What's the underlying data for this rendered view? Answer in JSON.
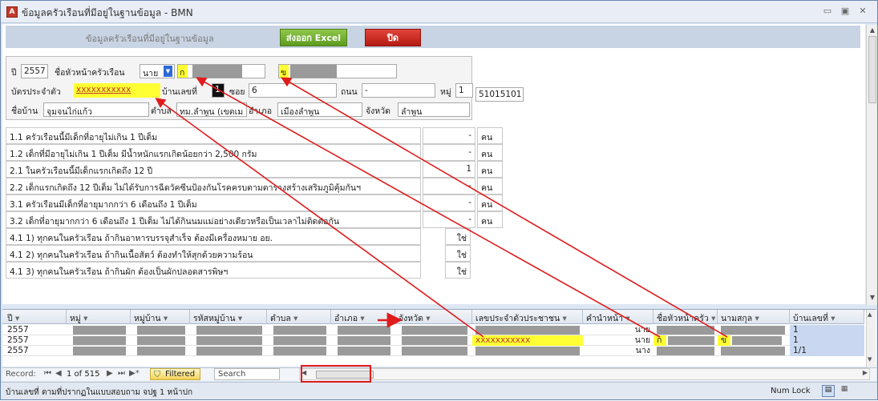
{
  "window": {
    "title": "ข้อมูลครัวเรือนที่มีอยู่ในฐานข้อมูล - BMN",
    "app_icon": "A"
  },
  "header": {
    "title": "ข้อมูลครัวเรือนที่มีอยู่ในฐานข้อมูล",
    "excel_label": "ส่งออก Excel",
    "close_label": "ปิด"
  },
  "info": {
    "year_label": "ปี",
    "year": "2557",
    "head_label": "ชื่อหัวหน้าครัวเรือน",
    "prefix": "นาย",
    "first": "ก",
    "last": "ข",
    "id_label": "บัตรประจำตัว",
    "id_value": "xxxxxxxxxxx",
    "house_label": "บ้านเลขที่",
    "house_no": "1",
    "soi_label": "ซอย",
    "soi": "6",
    "road_label": "ถนน",
    "road": "-",
    "moo_label": "หมู่",
    "moo": "1",
    "code": "51015101",
    "village_label": "ชื่อบ้าน",
    "village": "จุมจนไก่แก้ว",
    "tambon_label": "ตำบล",
    "tambon": "ทม.ลำพูน (เขตเม",
    "amphoe_label": "อำเภอ",
    "amphoe": "เมืองลำพูน",
    "province_label": "จังหวัด",
    "province": "ลำพูน"
  },
  "questions": [
    {
      "text": "1.1 ครัวเรือนนี้มีเด็กที่อายุไม่เกิน 1 ปีเต็ม",
      "value": "-",
      "unit": "คน"
    },
    {
      "text": "1.2 เด็กที่มีอายุไม่เกิน 1 ปีเต็ม มีน้ำหนักแรกเกิดน้อยกว่า 2,500 กรัม",
      "value": "-",
      "unit": "คน"
    },
    {
      "text": "2.1 ในครัวเรือนนี้มีเด็กแรกเกิดถึง 12 ปี",
      "value": "1",
      "unit": "คน"
    },
    {
      "text": "2.2 เด็กแรกเกิดถึง 12 ปีเต็ม ไม่ได้รับการฉีดวัคซีนป้องกันโรคครบตามตารางสร้างเสริมภูมิคุ้มกันฯ",
      "value": "-",
      "unit": "คน"
    },
    {
      "text": "3.1 ครัวเรือนมีเด็กที่อายุมากกว่า 6 เดือนถึง 1 ปีเต็ม",
      "value": "-",
      "unit": "คน"
    },
    {
      "text": "3.2 เด็กที่อายุมากกว่า 6 เดือนถึง 1 ปีเต็ม ไม่ได้กินนมแม่อย่างเดียวหรือเป็นเวลาไม่ติดต่อกัน",
      "value": "-",
      "unit": "คน"
    },
    {
      "text": "4.1 1) ทุกคนในครัวเรือน ถ้ากินอาหารบรรจุสำเร็จ ต้องมีเครื่องหมาย อย.",
      "value": "ใช่",
      "unit": ""
    },
    {
      "text": "4.1 2) ทุกคนในครัวเรือน ถ้ากินเนื้อสัตว์ ต้องทำให้สุกด้วยความร้อน",
      "value": "ใช่",
      "unit": ""
    },
    {
      "text": "4.1 3) ทุกคนในครัวเรือน ถ้ากินผัก ต้องเป็นผักปลอดสารพิษฯ",
      "value": "ใช่",
      "unit": ""
    }
  ],
  "grid": {
    "headers": [
      "ปี",
      "หมู่",
      "หมู่บ้าน",
      "รหัสหมู่บ้าน",
      "ตำบล",
      "อำเภอ",
      "จังหวัด",
      "เลขประจำตัวประชาชน",
      "คำนำหน้า",
      "ชื่อหัวหน้าครัว",
      "นามสกุล",
      "บ้านเลขที่"
    ],
    "rows": [
      {
        "year": "2557",
        "id": "",
        "prefix": "นาย",
        "first": "",
        "last": "",
        "house": "1"
      },
      {
        "year": "2557",
        "id": "xxxxxxxxxxx",
        "prefix": "นาย",
        "first": "ก",
        "last": "ข",
        "house": "1"
      },
      {
        "year": "2557",
        "id": "",
        "prefix": "นาง",
        "first": "",
        "last": "",
        "house": "1/1"
      }
    ]
  },
  "nav": {
    "record_label": "Record:",
    "position": "1 of 515",
    "filter_label": "Filtered",
    "search_label": "Search"
  },
  "status": {
    "text": "บ้านเลขที่ ตามที่ปรากฏในแบบสอบถาม จปฐ 1 หน้าปก",
    "numlock": "Num Lock"
  },
  "colors": {
    "highlight": "#ffff33",
    "arrow": "#e01b1b",
    "excel_button": "#6aa828",
    "close_button": "#cc2a20"
  }
}
